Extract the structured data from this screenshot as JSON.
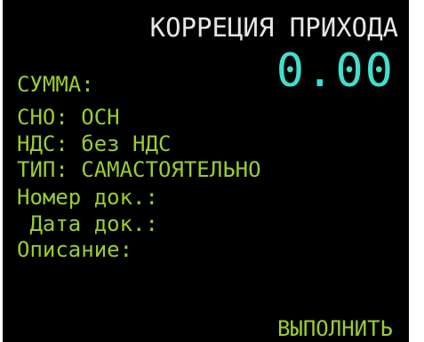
{
  "screen": {
    "title": "КОРРЕЦИЯ ПРИХОДА",
    "amount_label": "СУММА:",
    "amount_value": "0.00",
    "sno": "СНО: ОСН",
    "nds": "НДС: без НДС",
    "type": "ТИП: САМАСТОЯТЕЛЬНО",
    "doc_number": "Номер док.:",
    "doc_date": " Дата док.:",
    "description": "Описание:",
    "action": "ВЫПОЛНИТЬ"
  },
  "colors": {
    "background": "#000000",
    "title": "#e6e6e6",
    "label": "#9acd32",
    "amount": "#40e0d0"
  }
}
